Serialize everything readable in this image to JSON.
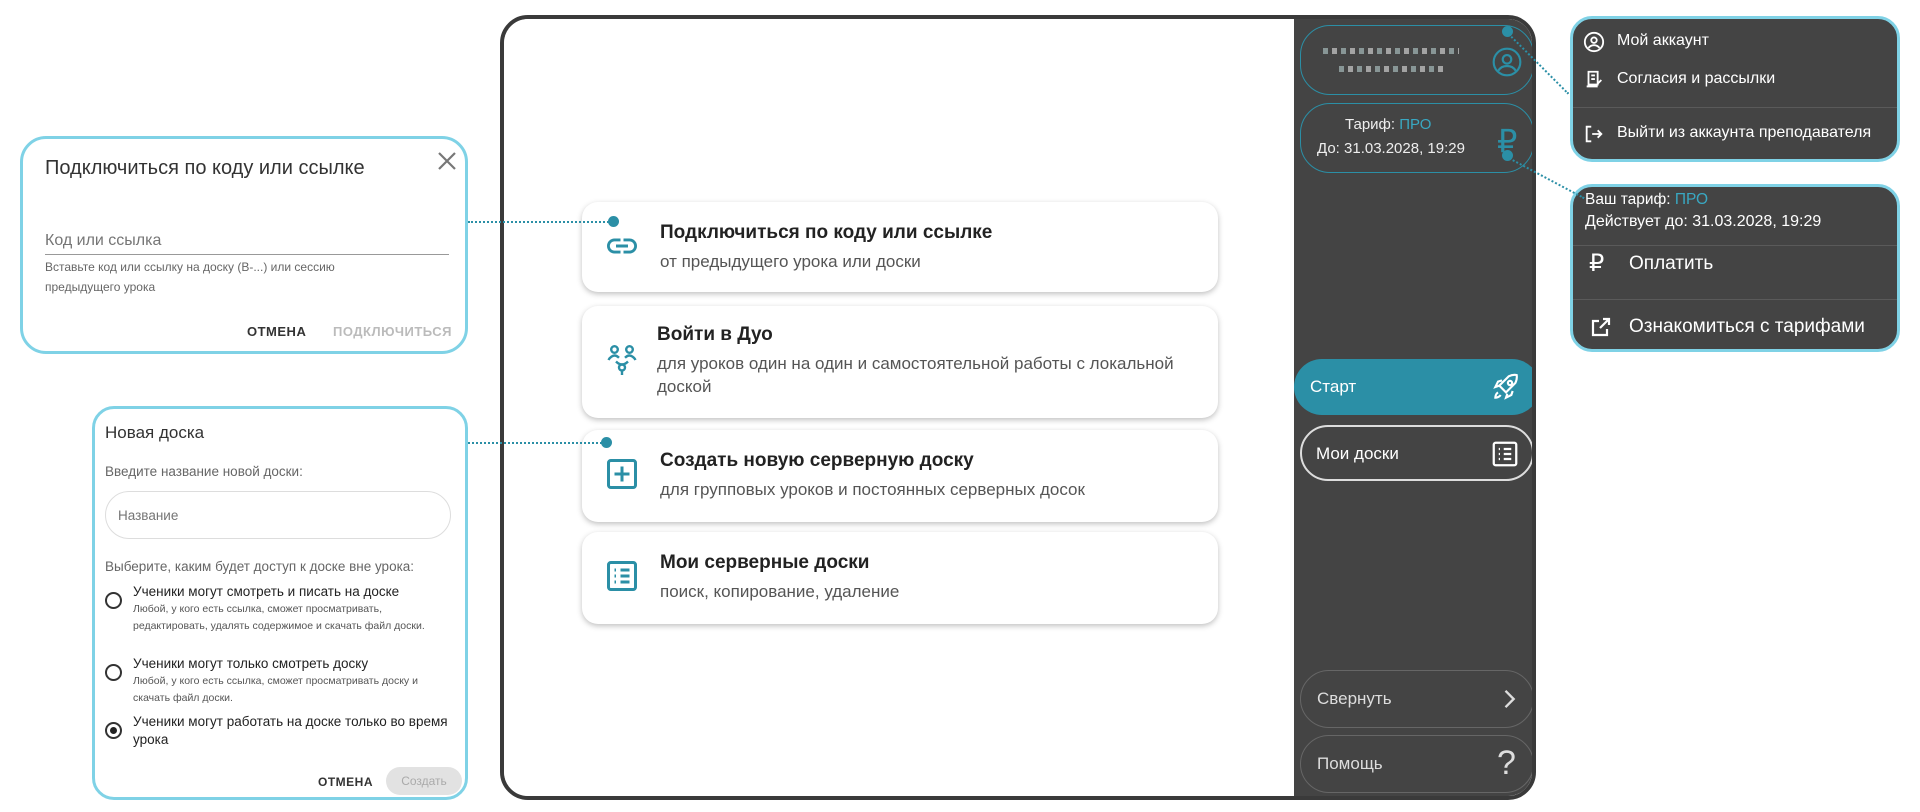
{
  "connect_dialog": {
    "title": "Подключиться по коду или ссылке",
    "field_placeholder": "Код или ссылка",
    "helper": "Вставьте код или ссылку на доску (B-...) или сессию предыдущего урока",
    "cancel": "ОТМЕНА",
    "connect": "ПОДКЛЮЧИТЬСЯ"
  },
  "new_board_dialog": {
    "title": "Новая доска",
    "name_label": "Введите название новой доски:",
    "name_placeholder": "Название",
    "access_label": "Выберите, каким будет доступ к доске вне урока:",
    "options": [
      {
        "title": "Ученики могут смотреть и писать на доске",
        "desc": "Любой, у кого есть ссылка, сможет просматривать, редактировать, удалять содержимое и скачать файл доски.",
        "selected": false
      },
      {
        "title": "Ученики могут только смотреть доску",
        "desc": "Любой, у кого есть ссылка, сможет просматривать доску и скачать файл доски.",
        "selected": false
      },
      {
        "title": "Ученики могут работать на доске только во время урока",
        "desc": "",
        "selected": true
      }
    ],
    "cancel": "ОТМЕНА",
    "create": "Создать"
  },
  "main_cards": [
    {
      "title": "Подключиться по коду или ссылке",
      "subtitle": "от предыдущего урока или доски",
      "icon": "link-icon"
    },
    {
      "title": "Войти в Дуо",
      "subtitle": "для уроков один на один и самостоятельной работы с локальной доской",
      "icon": "duo-icon"
    },
    {
      "title": "Создать новую серверную доску",
      "subtitle": "для групповых уроков и постоянных серверных досок",
      "icon": "add-box-icon"
    },
    {
      "title": "Мои серверные доски",
      "subtitle": "поиск, копирование, удаление",
      "icon": "list-icon"
    }
  ],
  "sidebar": {
    "tariff_label": "Тариф:",
    "tariff_value": "ПРО",
    "tariff_until": "До: 31.03.2028, 19:29",
    "nav": [
      {
        "label": "Старт",
        "icon": "rocket-icon",
        "active": true
      },
      {
        "label": "Мои доски",
        "icon": "list-icon",
        "active": false
      }
    ],
    "collapse": "Свернуть",
    "help": "Помощь"
  },
  "account_menu": {
    "items": [
      {
        "label": "Мой аккаунт",
        "icon": "account-circle-icon"
      },
      {
        "label": "Согласия и рассылки",
        "icon": "document-icon"
      },
      {
        "label": "Выйти из аккаунта преподавателя",
        "icon": "logout-icon"
      }
    ]
  },
  "tariff_menu": {
    "label": "Ваш тариф:",
    "value": "ПРО",
    "until": "Действует до: 31.03.2028, 19:29",
    "pay": "Оплатить",
    "plans": "Ознакомиться с тарифами"
  },
  "colors": {
    "accent": "#2b8fa6",
    "callout_border": "#7fd2e6",
    "sidebar": "#444444"
  }
}
